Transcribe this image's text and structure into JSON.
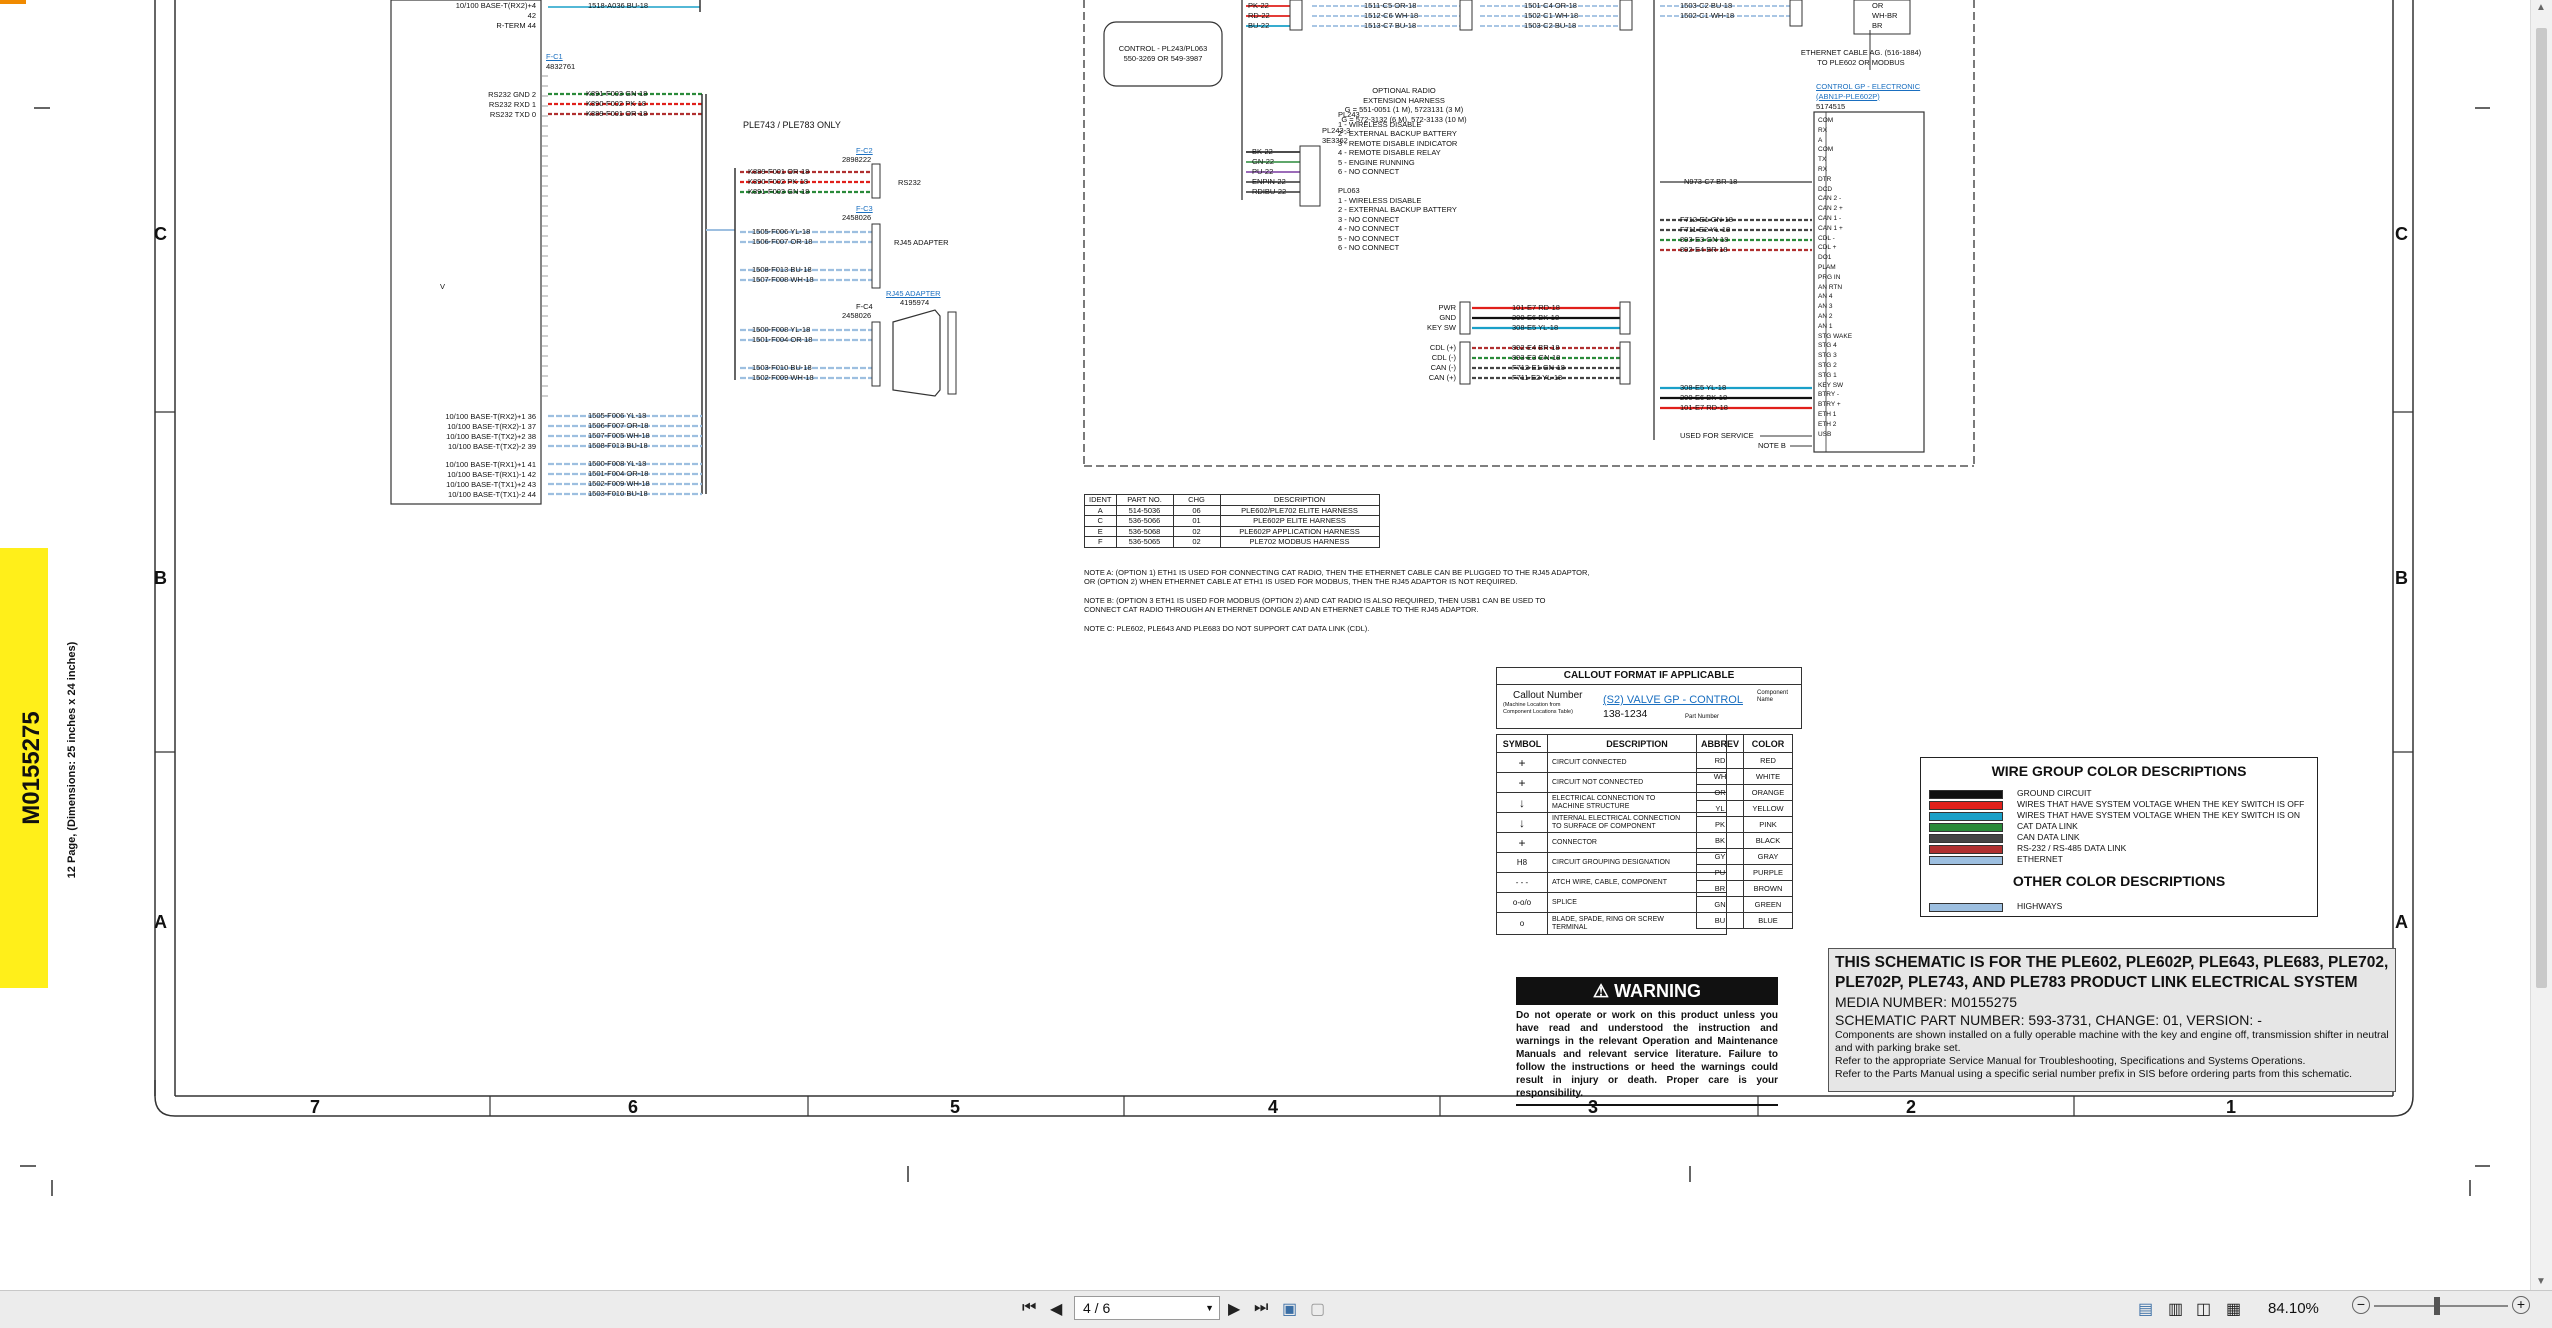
{
  "sidebar_tab": {
    "media_number": "M0155275",
    "pages_info": "12 Page, (Dimensions: 25 inches x 24 inches)"
  },
  "zones": {
    "rows": [
      "C",
      "B",
      "A"
    ],
    "cols": [
      "7",
      "6",
      "5",
      "4",
      "3",
      "2",
      "1"
    ]
  },
  "schematic": {
    "fc1_label": "F-C1",
    "fc1_part": "4832761",
    "ple743_label": "PLE743 / PLE783 ONLY",
    "fc2_label": "F-C2",
    "fc2_part": "2898222",
    "rs232_label": "RS232",
    "fc3_label": "F-C3",
    "fc3_part": "2458026",
    "rj45_adapter_label": "RJ45 ADAPTER",
    "fc4_label": "F-C4",
    "fc4_part": "2458026",
    "rj45_adapter_link": "RJ45 ADAPTER",
    "rj45_adapter_part": "4195974",
    "left_wires": [
      "K891-F003 GN-18",
      "K890-F002 PK-18",
      "K889-F001 OR-18"
    ],
    "rs232_pins": [
      "RS232 GND 2",
      "RS232 RXD 1",
      "RS232 TXD 0"
    ],
    "fc2_wires": [
      "K889-F001 OR-18",
      "K890-F002 PK-18",
      "K891-F003 GN-18"
    ],
    "fc3_wires": [
      "1505-F006 YL-18",
      "1506-F007 OR-18",
      "1508-F013 BU-18",
      "1507-F008 WH-18"
    ],
    "fc4_wires": [
      "1500-F008 YL-18",
      "1501-F004 OR-18",
      "1503-F010 BU-18",
      "1502-F009 WH-18"
    ],
    "eth_wires": [
      "1505-F006 YL-18",
      "1506-F007 OR-18",
      "1507-F005 WH-18",
      "1508-F013 BU-18",
      "1500-F008 YL-18",
      "1501-F004 OR-18",
      "1502-F009 WH-18",
      "1503-F010 BU-18"
    ],
    "eth_pins": [
      "10/100 BASE-T(RX2)+1 36",
      "10/100 BASE-T(RX2)-1 37",
      "10/100 BASE-T(TX2)+2 38",
      "10/100 BASE-T(TX2)-2 39",
      "10/100 BASE-T(RX1)+1 41",
      "10/100 BASE-T(RX1)-1 42",
      "10/100 BASE-T(TX1)+2 43",
      "10/100 BASE-T(TX1)-2 44"
    ],
    "top_pins": [
      "10/100 BASE-T(RX2)+4 42",
      "R-TERM 44"
    ],
    "top_wire": "1518-A036 BU-18",
    "control_box": "CONTROL - PL243/PL063\n550-3269 OR 549-3987",
    "optional_radio": "OPTIONAL RADIO\nEXTENSION HARNESS\nG = 551-0051 (1 M), 5723131 (3 M)\nG = 572-3132 (6 M), 572-3133 (10 M)",
    "pl243_label": "PL243-3\n3E3362",
    "pl243_list": "PL243\n1 - WIRELESS DISABLE\n2 - EXTERNAL BACKUP BATTERY\n3 - REMOTE DISABLE INDICATOR\n4 - REMOTE DISABLE RELAY\n5 - ENGINE RUNNING\n6 - NO CONNECT",
    "pl063_list": "PL063\n1 - WIRELESS DISABLE\n2 - EXTERNAL BACKUP BATTERY\n3 - NO CONNECT\n4 - NO CONNECT\n5 - NO CONNECT\n6 - NO CONNECT",
    "top_right_wires": [
      "PK-22",
      "RD-22",
      "BU-22"
    ],
    "top_mid_wires": [
      "1511-C5 OR-18",
      "1512-C6 WH-18",
      "1513-C7 BU-18"
    ],
    "top_mid2_wires": [
      "1501-C4 OR-18",
      "1502-C1 WH-18",
      "1503-C2 BU-18"
    ],
    "top_mid3_wires": [
      "1503-C2 BU-18",
      "1502-C1 WH-18"
    ],
    "radio_pins": [
      "BK-22",
      "GN-22",
      "PU-22",
      "ENPIN-22",
      "RDIBU-22"
    ],
    "pwr_labels": [
      "PWR",
      "GND",
      "KEY SW"
    ],
    "pwr_wires": [
      "101-E7 RD-18",
      "200-E6 BK-18",
      "308-E5 YL-18"
    ],
    "cdl_labels": [
      "CDL (+)",
      "CDL (-)",
      "CAN (-)",
      "CAN (+)"
    ],
    "cdl_wires": [
      "892-E4 BR-18",
      "893-E3 GN-18",
      "F712-E1 GN-18",
      "F711-E2 YL-18"
    ],
    "right_wires_a": [
      "F712-E1 GN-18",
      "F711-E2 YL-18",
      "893-E3 GN-18",
      "892-E4 BR-18"
    ],
    "right_wires_b": [
      "308-E5 YL-18",
      "200-E6 BK-18",
      "101-E7 RD-18"
    ],
    "n973": "N973-C7 BR-18",
    "used_for_service": "USED FOR SERVICE",
    "note_b_tag": "NOTE B",
    "ethernet_cable": "ETHERNET CABLE AG. (516-1884)\nTO PLE602 OR MODBUS",
    "control_gp_link": "CONTROL GP - ELECTRONIC\n(ABN1P-PLE602P)",
    "control_gp_part": "5174515",
    "control_gp_pins": [
      "COM",
      "RX",
      "A",
      "COM",
      "TX",
      "RX",
      "DTR",
      "DCD",
      "CAN 2 -",
      "CAN 2 +",
      "CAN 1 -",
      "CAN 1 +",
      "CDL -",
      "CDL +",
      "DO1",
      "PLAM",
      "PRG IN",
      "AN RTN",
      "AN 4",
      "AN 3",
      "AN 2",
      "AN 1",
      "STG WAKE",
      "STG 4",
      "STG 3",
      "STG 2",
      "STG 1",
      "KEY SW",
      "BTRY -",
      "BTRY +",
      "ETH 1",
      "ETH 2",
      "USB"
    ],
    "top_conn_wires": [
      "OR",
      "WH-BR",
      "BR"
    ],
    "v_label": "V"
  },
  "ident_table": {
    "headers": [
      "IDENT",
      "PART NO.",
      "CHG",
      "DESCRIPTION"
    ],
    "rows": [
      [
        "A",
        "514-5036",
        "06",
        "PLE602/PLE702 ELITE HARNESS"
      ],
      [
        "C",
        "536-5066",
        "01",
        "PLE602P ELITE HARNESS"
      ],
      [
        "E",
        "536-5068",
        "02",
        "PLE602P APPLICATION HARNESS"
      ],
      [
        "F",
        "536-5065",
        "02",
        "PLE702 MODBUS HARNESS"
      ]
    ]
  },
  "notes": [
    "NOTE A: (OPTION 1) ETH1 IS USED FOR CONNECTING CAT RADIO, THEN THE ETHERNET CABLE CAN BE PLUGGED TO THE RJ45 ADAPTOR,",
    "OR (OPTION 2) WHEN ETHERNET CABLE AT ETH1 IS USED FOR MODBUS, THEN THE RJ45 ADAPTOR IS NOT REQUIRED.",
    "NOTE B: (OPTION 3 ETH1 IS USED FOR MODBUS (OPTION 2) AND CAT RADIO IS ALSO REQUIRED, THEN USB1 CAN BE USED TO",
    "CONNECT CAT RADIO THROUGH AN ETHERNET DONGLE AND AN ETHERNET CABLE TO THE RJ45 ADAPTOR.",
    "NOTE C: PLE602, PLE643 AND PLE683 DO NOT SUPPORT CAT DATA LINK (CDL)."
  ],
  "callout": {
    "title": "CALLOUT FORMAT IF APPLICABLE",
    "callout_number": "Callout Number",
    "callout_sub": "(Machine Location from\nComponent Locations Table)",
    "link": "(S2) VALVE GP - CONTROL",
    "part": "138-1234",
    "component_name": "Component\nName",
    "part_number": "Part Number"
  },
  "symbol_table": {
    "headers": [
      "SYMBOL",
      "DESCRIPTION"
    ],
    "rows": [
      [
        "+",
        "CIRCUIT CONNECTED"
      ],
      [
        "+",
        "CIRCUIT NOT CONNECTED"
      ],
      [
        "↓",
        "ELECTRICAL CONNECTION TO\nMACHINE STRUCTURE"
      ],
      [
        "↓",
        "INTERNAL ELECTRICAL CONNECTION\nTO SURFACE OF COMPONENT"
      ],
      [
        "+",
        "CONNECTOR"
      ],
      [
        "H8",
        "CIRCUIT GROUPING DESIGNATION"
      ],
      [
        "- - -",
        "ATCH WIRE, CABLE, COMPONENT"
      ],
      [
        "o-o/o",
        "SPLICE"
      ],
      [
        "o",
        "BLADE, SPADE, RING OR SCREW\nTERMINAL"
      ]
    ]
  },
  "color_table": {
    "headers": [
      "ABBREV",
      "COLOR"
    ],
    "rows": [
      [
        "RD",
        "RED"
      ],
      [
        "WH",
        "WHITE"
      ],
      [
        "OR",
        "ORANGE"
      ],
      [
        "YL",
        "YELLOW"
      ],
      [
        "PK",
        "PINK"
      ],
      [
        "BK",
        "BLACK"
      ],
      [
        "GY",
        "GRAY"
      ],
      [
        "PU",
        "PURPLE"
      ],
      [
        "BR",
        "BROWN"
      ],
      [
        "GN",
        "GREEN"
      ],
      [
        "BU",
        "BLUE"
      ]
    ]
  },
  "wire_group": {
    "title": "WIRE GROUP COLOR DESCRIPTIONS",
    "rows": [
      {
        "label": "GROUND CIRCUIT",
        "color": "#111111"
      },
      {
        "label": "WIRES THAT HAVE SYSTEM VOLTAGE WHEN THE KEY SWITCH IS OFF",
        "color": "#e0201b"
      },
      {
        "label": "WIRES THAT HAVE SYSTEM VOLTAGE WHEN THE KEY SWITCH IS ON",
        "color": "#1aa0c8"
      },
      {
        "label": "CAT DATA LINK",
        "color": "#2a8a3a"
      },
      {
        "label": "CAN DATA LINK",
        "color": "#444444"
      },
      {
        "label": "RS-232 / RS-485 DATA LINK",
        "color": "#b03030"
      },
      {
        "label": "ETHERNET",
        "color": "#9dbfe0"
      }
    ],
    "other_title": "OTHER COLOR DESCRIPTIONS",
    "other_rows": [
      {
        "label": "HIGHWAYS",
        "color": "#9dbfe0"
      }
    ]
  },
  "warning": {
    "title": "WARNING",
    "text": "Do not operate or work on this product unless you have read and understood the instruction and warnings in the relevant Operation and Maintenance Manuals and relevant service literature. Failure to follow the instructions or heed the warnings could result in injury or death. Proper care is your responsibility."
  },
  "title_block": {
    "heading": "THIS SCHEMATIC IS FOR THE PLE602, PLE602P, PLE643, PLE683, PLE702, PLE702P, PLE743, AND PLE783 PRODUCT LINK ELECTRICAL SYSTEM",
    "media": "MEDIA NUMBER: M0155275",
    "part": "SCHEMATIC PART NUMBER: 593-3731, CHANGE: 01, VERSION: -",
    "line1": "Components are shown installed on a fully operable machine with the key and engine off, transmission shifter in neutral and with parking brake set.",
    "line2": "Refer to the appropriate Service Manual for Troubleshooting, Specifications and Systems Operations.",
    "line3": "Refer to the Parts Manual using a specific serial number prefix in SIS before ordering parts from this schematic."
  },
  "toolbar": {
    "page_display": "4 / 6",
    "zoom": "84.10%",
    "zoom_minus": "−",
    "zoom_plus": "+"
  },
  "colors": {
    "yellow_tab": "#ffef1a",
    "red": "#e0201b",
    "cyan": "#1aa0c8",
    "black": "#111111"
  }
}
